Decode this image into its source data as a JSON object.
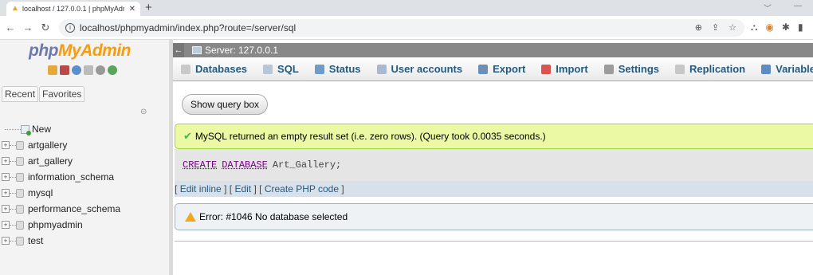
{
  "browser": {
    "tab_title": "localhost / 127.0.0.1 | phpMyAdm",
    "url": "localhost/phpmyadmin/index.php?route=/server/sql"
  },
  "nav": {
    "logo_php": "php",
    "logo_myadmin": "MyAdmin",
    "tabs": [
      "Recent",
      "Favorites"
    ],
    "new_label": "New",
    "databases": [
      "artgallery",
      "art_gallery",
      "information_schema",
      "mysql",
      "performance_schema",
      "phpmyadmin",
      "test"
    ]
  },
  "server": {
    "label": "Server: 127.0.0.1"
  },
  "menu": [
    {
      "label": "Databases",
      "icon": "database-icon",
      "color": "#c9c9c9"
    },
    {
      "label": "SQL",
      "icon": "sql-icon",
      "color": "#b5c7d9"
    },
    {
      "label": "Status",
      "icon": "status-icon",
      "color": "#6f9bc6"
    },
    {
      "label": "User accounts",
      "icon": "users-icon",
      "color": "#a9b9cf"
    },
    {
      "label": "Export",
      "icon": "export-icon",
      "color": "#6b8fb7"
    },
    {
      "label": "Import",
      "icon": "import-icon",
      "color": "#d9534f"
    },
    {
      "label": "Settings",
      "icon": "wrench-icon",
      "color": "#9c9c9c"
    },
    {
      "label": "Replication",
      "icon": "replication-icon",
      "color": "#c7c7c7"
    },
    {
      "label": "Variables",
      "icon": "variables-icon",
      "color": "#5b8cc4"
    }
  ],
  "main": {
    "show_query_box": "Show query box",
    "success_message": "MySQL returned an empty result set (i.e. zero rows). (Query took 0.0035 seconds.)",
    "sql_kw1": "CREATE",
    "sql_kw2": "DATABASE",
    "sql_rest": "Art_Gallery;",
    "edit_inline": "Edit inline",
    "edit": "Edit",
    "create_php": "Create PHP code",
    "error_message": "Error: #1046 No database selected"
  }
}
